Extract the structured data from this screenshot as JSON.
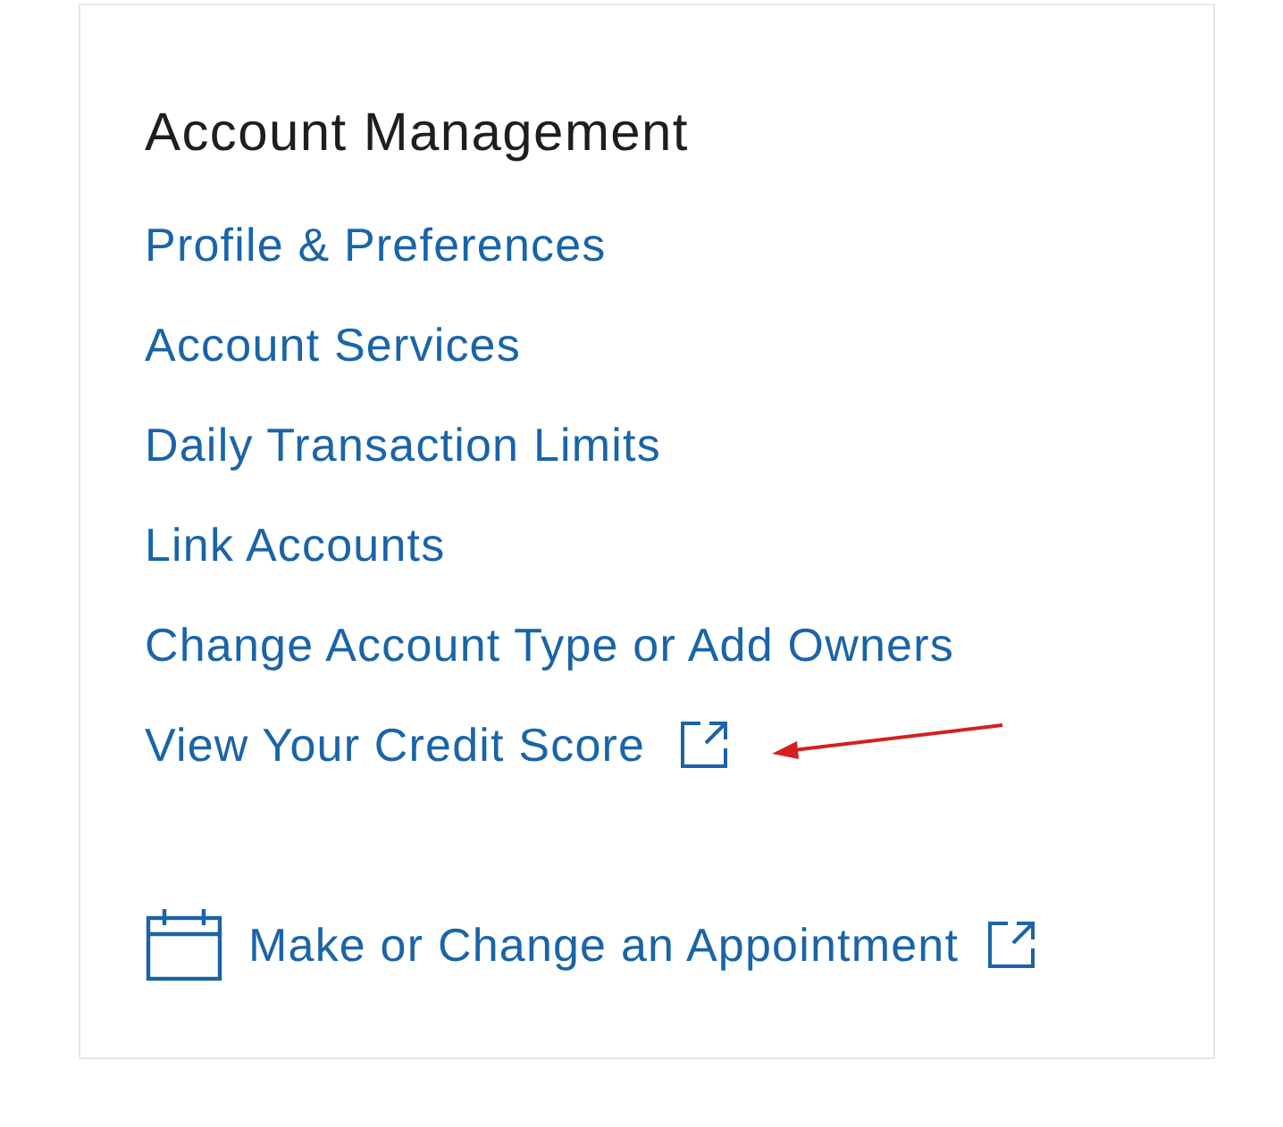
{
  "section": {
    "title": "Account Management",
    "links": [
      {
        "label": "Profile & Preferences",
        "external": false
      },
      {
        "label": "Account Services",
        "external": false
      },
      {
        "label": "Daily Transaction Limits",
        "external": false
      },
      {
        "label": "Link Accounts",
        "external": false
      },
      {
        "label": "Change Account Type or Add Owners",
        "external": false
      },
      {
        "label": "View Your Credit Score",
        "external": true
      }
    ],
    "appointment": {
      "label": "Make or Change an Appointment",
      "external": true
    }
  }
}
